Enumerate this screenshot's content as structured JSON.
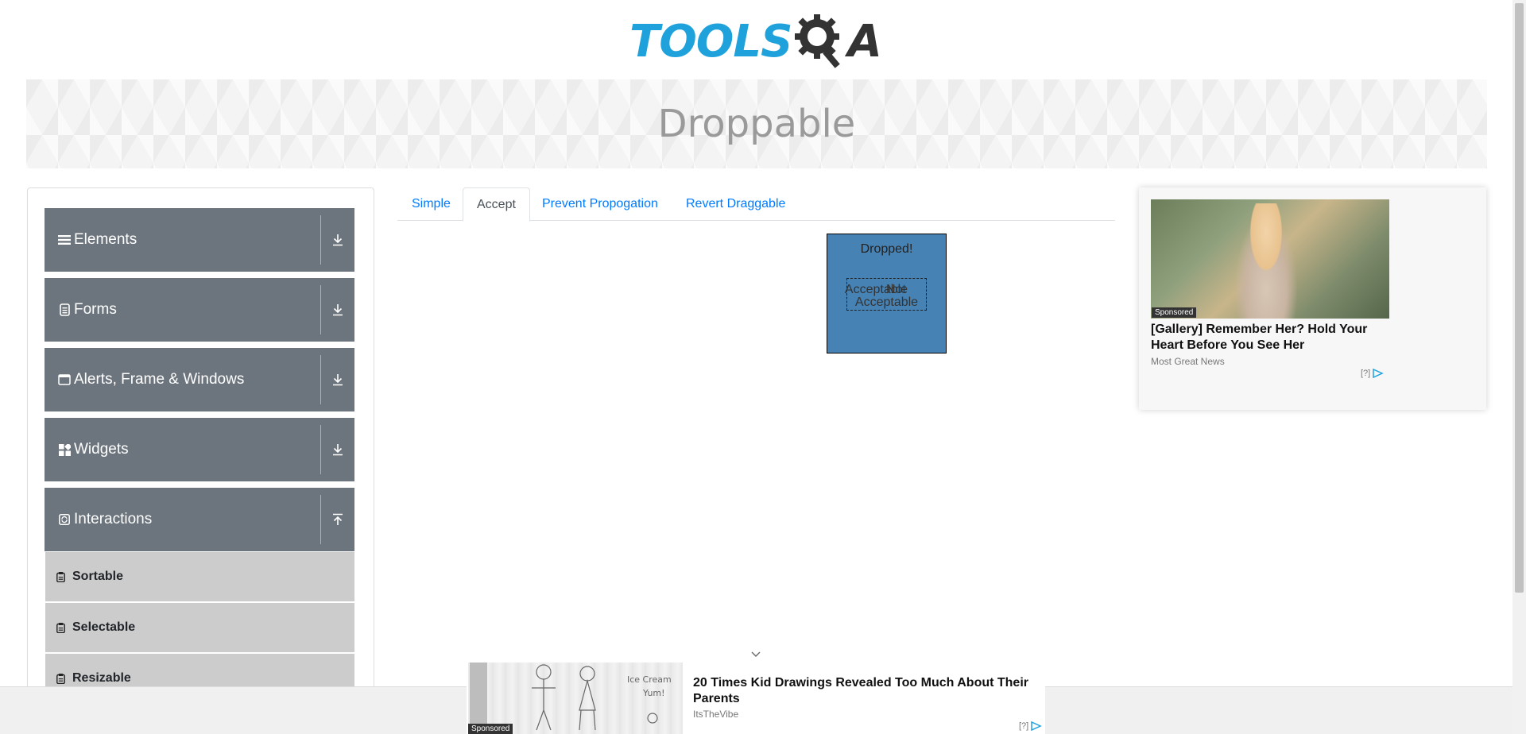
{
  "header": {
    "logo_text": "TOOLS",
    "logo_suffix": "A",
    "logo_colors": {
      "blue": "#1fa2dc",
      "dark": "#333333"
    }
  },
  "banner": {
    "title": "Droppable"
  },
  "sidebar": {
    "groups": [
      {
        "label": "Elements",
        "icon": "list-icon",
        "expanded": false
      },
      {
        "label": "Forms",
        "icon": "form-icon",
        "expanded": false
      },
      {
        "label": "Alerts, Frame & Windows",
        "icon": "window-icon",
        "expanded": false
      },
      {
        "label": "Widgets",
        "icon": "widgets-icon",
        "expanded": false
      },
      {
        "label": "Interactions",
        "icon": "interactions-icon",
        "expanded": true
      }
    ],
    "interaction_items": [
      {
        "label": "Sortable"
      },
      {
        "label": "Selectable"
      },
      {
        "label": "Resizable"
      }
    ]
  },
  "tabs": [
    {
      "label": "Simple",
      "active": false
    },
    {
      "label": "Accept",
      "active": true
    },
    {
      "label": "Prevent Propogation",
      "active": false
    },
    {
      "label": "Revert Draggable",
      "active": false
    }
  ],
  "droppable": {
    "status_text": "Dropped!",
    "acceptable_label": "Acceptable",
    "not_acceptable_label": "Not Acceptable",
    "box_color": "#4682b4"
  },
  "ad_right": {
    "sponsored": "Sponsored",
    "title": "[Gallery] Remember Her? Hold Your Heart Before You See Her",
    "source": "Most Great News",
    "info": "[?]"
  },
  "ad_bottom": {
    "sponsored": "Sponsored",
    "title": "20 Times Kid Drawings Revealed Too Much About Their Parents",
    "source": "ItsTheVibe",
    "info": "[?]"
  }
}
